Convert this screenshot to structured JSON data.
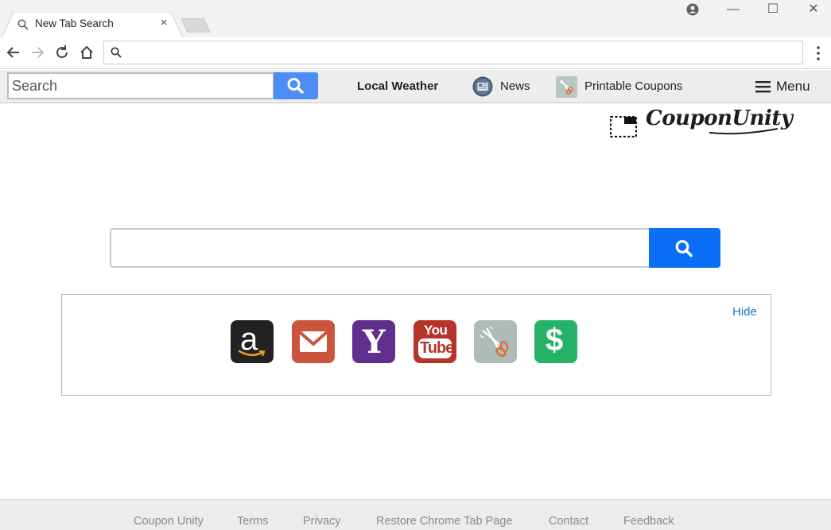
{
  "browser": {
    "tab_title": "New Tab Search",
    "tab_close": "×",
    "window_controls": {
      "minimize": "—",
      "maximize": "☐",
      "close": "✕"
    },
    "omnibox_value": ""
  },
  "extension_bar": {
    "search_placeholder": "Search",
    "local_weather": "Local Weather",
    "news": "News",
    "printable_coupons": "Printable Coupons",
    "menu": "Menu"
  },
  "logo": {
    "text": "CouponUnity"
  },
  "main_search": {
    "placeholder": ""
  },
  "tiles": {
    "hide_label": "Hide",
    "items": [
      {
        "name": "amazon",
        "color": "#222222"
      },
      {
        "name": "gmail",
        "color": "#c9553f"
      },
      {
        "name": "yahoo",
        "color": "#61308f"
      },
      {
        "name": "youtube",
        "color": "#b5352a"
      },
      {
        "name": "printable-coupons",
        "color": "#aebbb6"
      },
      {
        "name": "cash",
        "color": "#27b26a"
      }
    ],
    "youtube_top": "You",
    "youtube_bottom": "Tube",
    "yahoo_letter": "Y",
    "cash_symbol": "$",
    "amazon_letter": "a"
  },
  "footer": {
    "links": [
      "Coupon Unity",
      "Terms",
      "Privacy",
      "Restore Chrome Tab Page",
      "Contact",
      "Feedback"
    ]
  },
  "colors": {
    "accent_blue": "#0b6ef6",
    "ext_button_blue": "#4c8df6",
    "link_blue": "#1a73c9"
  }
}
